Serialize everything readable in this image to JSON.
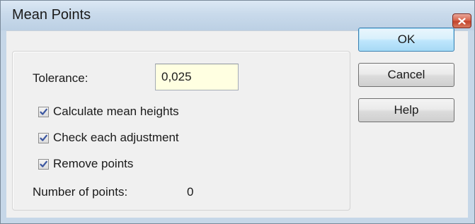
{
  "window": {
    "title": "Mean Points",
    "close_icon": "close-icon",
    "colors": {
      "frame": "#c6d7e8",
      "client": "#f0f0f0",
      "close_button": "#c2432c",
      "input_background": "#ffffe1",
      "default_button_border": "#3c7fb1"
    }
  },
  "form": {
    "tolerance_label": "Tolerance:",
    "tolerance_value": "0,025",
    "checkboxes": [
      {
        "label": "Calculate mean heights",
        "checked": true
      },
      {
        "label": "Check each adjustment",
        "checked": true
      },
      {
        "label": "Remove points",
        "checked": true
      }
    ],
    "count_label": "Number of points:",
    "count_value": "0"
  },
  "buttons": {
    "ok": "OK",
    "cancel": "Cancel",
    "help": "Help"
  }
}
